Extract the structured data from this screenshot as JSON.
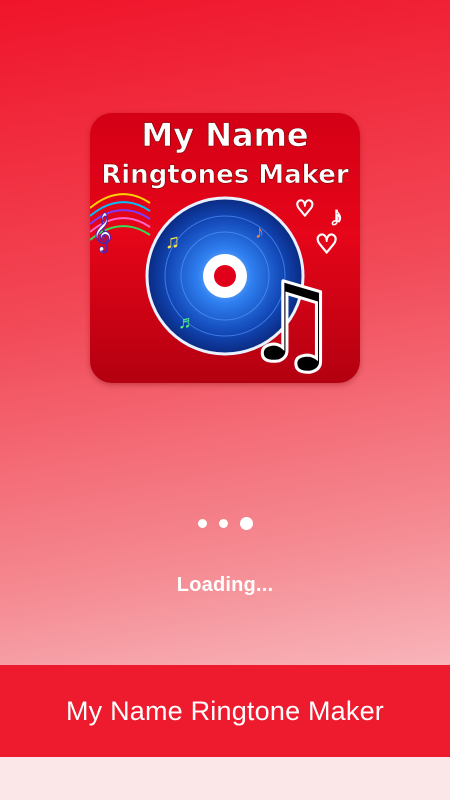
{
  "splash": {
    "icon": {
      "name": "app-logo",
      "title_line1": "My Name",
      "title_line2": "Ringtones Maker"
    },
    "loading_text": "Loading...",
    "dots": [
      {
        "active": false
      },
      {
        "active": false
      },
      {
        "active": true
      }
    ]
  },
  "footer": {
    "title": "My Name Ringtone Maker"
  },
  "colors": {
    "brand_red": "#ee1b2e",
    "icon_red": "#e60519",
    "disc_blue": "#1a5fd0"
  }
}
